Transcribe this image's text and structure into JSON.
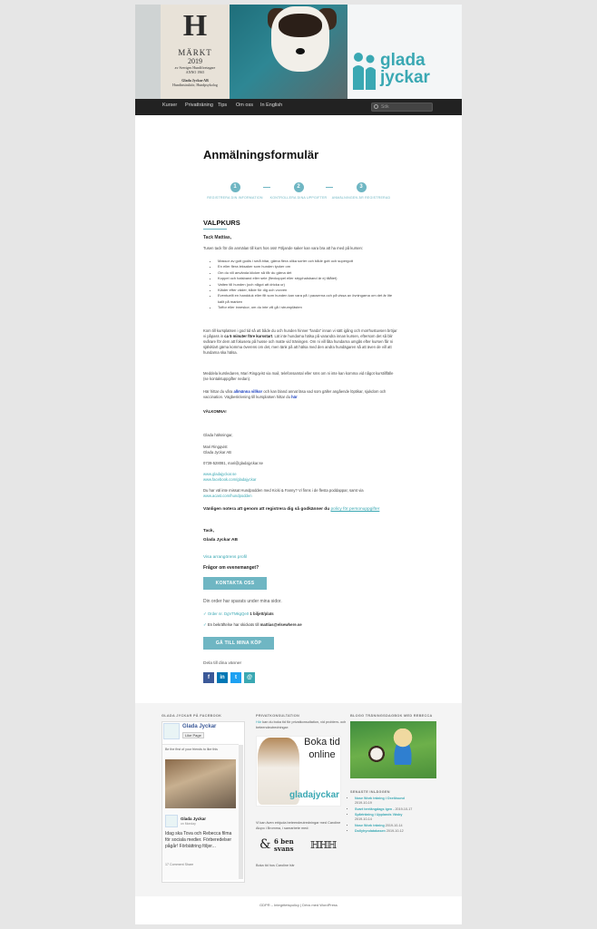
{
  "header": {
    "badge": {
      "letter": "H",
      "mark": "MÄRKT",
      "year": "2019",
      "org": "av Sveriges Hundföretagare",
      "since": "ANNO 1965",
      "owner": "Glada Jyckar AB",
      "owner_sub": "Hundinstruktör, Hundpsykolog"
    },
    "logo_line1": "glada",
    "logo_line2": "jyckar"
  },
  "nav": {
    "items": [
      "Kurser",
      "Privatträning",
      "Tips",
      "Om oss",
      "In English"
    ],
    "search_placeholder": "Sök"
  },
  "main": {
    "title": "Anmälningsformulär",
    "steps": [
      {
        "num": "1",
        "label": "REGISTRERA DIN INFORMATION"
      },
      {
        "num": "2",
        "label": "KONTROLLERA DINA UPPGIFTER"
      },
      {
        "num": "3",
        "label": "ANMÄLNINGEN ÄR REGISTRERAD"
      }
    ],
    "section_title": "VALPKURS",
    "greeting": "Tack Mattias,",
    "intro": "Tusen tack för din anmälan till kurs hos oss! Följande saker kan vara bra att ha med på kursen:",
    "list": [
      "Massor av gott godis i små bitar, gärna flera olika sorter och både gott och supergott",
      "En eller flera leksaker som hunden tycker om",
      "Om du vill använda klicker så får du gärna det",
      "Koppel och halsband eller sele (flexkoppel eller stryphalsband är ej tillåtet)",
      "Vatten till hunden (och något att dricka ur)",
      "Kläder efter väder, både för dig och vovven",
      "Eventuellt en handduk eller filt som hunden kan vara på i pauserna och på vissa av övningarna om det är lite kallt på marken",
      "Toffor eller inneskor, om du inte vill gå i strumplästen"
    ],
    "p1_a": "Kom till kursplatsen i god tid så att både du och hunden hinner \"landa\" innan vi sätt igång och morrhustuvsen bröjar vi påpass in ",
    "p1_bold": "ca 5 minuter före kursstart",
    "p1_b": ". Lät inte hundarna hälsa på varandra innan kursen, eftersom det så blir svårare för dem att fokusera på husse och matte vid träningen. Om ni vill låta hundarna umgås efter kursen får ni självklart gärna komma överens om det, men tänk på att hälsa med den andra hundägaren så att även de vill att hundarna ska hälsa.",
    "p2": "Meddela kursledaren, Mari Ringqvist via mail, telefonsamtal eller sms om ni inte kan komma vid något kurstillfälle (se kontaktuppgifter nedan).",
    "p3_a": "Här hittar du våra ",
    "p3_link": "allmänna villkor",
    "p3_b": " och kan bland annat läsa vad som gäller angående löptikar, sjukdom och vaccination. Vägbeskrivning till kursplatsen hittar du ",
    "p3_link2": "här",
    "welcome": "VÄLKOMNA!",
    "regards": "Glada hälsningar,",
    "sig_name": "Mari Ringqvist",
    "sig_company": "Glada Jyckar AB",
    "sig_contact": "0739-528081, mari@gladajyckar.se",
    "sig_web": "www.gladajyckar.se",
    "sig_fb": "www.facebook.com/gladajyckar",
    "podcast": "Du har väl inte missat Hundpodden med Kicki & Fanny? Vi finns i de flesta poddappar, samt via",
    "podcast_link": "www.acast.com/hundpodden",
    "gdpr_a": "Vänligen notera att genom att registrera dig så godkänner du ",
    "gdpr_link": "policy för personuppgifter",
    "thanks": "Tack,",
    "thanks_company": "Glada Jyckar AB",
    "organizer_profile": "Visa arrangörens profil",
    "questions": "Frågor om evenemanget?",
    "contact_btn": "KONTAKTA OSS",
    "saved_note": "Din order har sparats under mina sidor.",
    "order_label": "Order nr. DgVTMkgQe0",
    "order_detail": "1 biljett/plats",
    "confirm_a": "En bekräftelse har skickats till ",
    "confirm_email": "mattias@elsewhere.se",
    "mypurchases_btn": "GÅ TILL MINA KÖP",
    "share_label": "Dela till dina vänner"
  },
  "footer": {
    "fb_title": "GLADA JYCKAR PÅ FACEBOOK",
    "fb_name": "Glada Jyckar",
    "fb_like": "Like Page",
    "fb_friends": "Be the first of your friends to like this",
    "fb_post_name": "Glada Jyckar",
    "fb_post_time": "on Monday",
    "fb_post_text": "Idag ska Tova och Rebecca filma för sociala medier. Förberedelser pågår! Förbättring följer...",
    "fb_actions": "17  Comment  Share",
    "pk_title": "PRIVATKONSULTATION",
    "pk_link": "Här",
    "pk_text": " kan du boka tid för privatkonsultation, vid problem- och beteendeutredningar:",
    "pk_boka": "Boka tid online",
    "pk_logo": "gladajyckar",
    "pk_text2": "Vi kan även erbjuda beteendeutredningar med Caroline Alupo i Bromma, i samarbete med:",
    "ob_g": "&",
    "ob_a1": "6 ben",
    "ob_a2": "svans",
    "pk_link2": "Boka tid hos Caroline här",
    "blog_title": "BLOGG TRÄNINGSDAGBOK MED REBECCA",
    "recent_title": "SENASTE INLÄGGEN",
    "recent": [
      {
        "title": "Nose Work träning i Oxelösund",
        "date": "2019-10-19"
      },
      {
        "title": "Svart terriängdags igen - ",
        "date": "2019-10-17"
      },
      {
        "title": "Spårträning i Upplands Väsby",
        "date": "2019-10-14"
      },
      {
        "title": "Nose Work träning",
        "date": "2019-10-14"
      },
      {
        "title": "Dollyhyndatabasen",
        "date": "2019-10-12"
      }
    ],
    "bottom_a": "GDPR – Integritetspolicy",
    "bottom_sep": " | ",
    "bottom_b": "Drivs med WordPress"
  }
}
